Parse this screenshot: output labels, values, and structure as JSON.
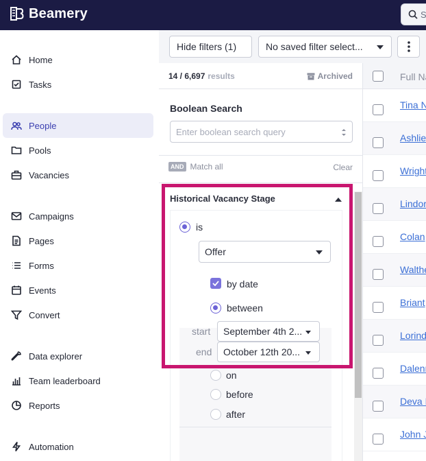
{
  "app": {
    "brand": "Beamery",
    "search_placeholder": "S"
  },
  "sidebar": {
    "items": [
      {
        "label": "Home",
        "icon": "home-icon"
      },
      {
        "label": "Tasks",
        "icon": "tasks-icon"
      },
      {
        "label": "People",
        "icon": "people-icon",
        "active": true
      },
      {
        "label": "Pools",
        "icon": "folder-icon"
      },
      {
        "label": "Vacancies",
        "icon": "briefcase-icon"
      },
      {
        "label": "Campaigns",
        "icon": "mail-icon"
      },
      {
        "label": "Pages",
        "icon": "page-icon"
      },
      {
        "label": "Forms",
        "icon": "list-icon"
      },
      {
        "label": "Events",
        "icon": "calendar-icon"
      },
      {
        "label": "Convert",
        "icon": "funnel-icon"
      },
      {
        "label": "Data explorer",
        "icon": "wrench-icon"
      },
      {
        "label": "Team leaderboard",
        "icon": "bar-chart-icon"
      },
      {
        "label": "Reports",
        "icon": "pie-chart-icon"
      },
      {
        "label": "Automation",
        "icon": "bolt-icon"
      }
    ]
  },
  "toolbar": {
    "hide_filters": "Hide filters (1)",
    "saved_filter": "No saved filter select..."
  },
  "results": {
    "count": "14 / 6,697",
    "label": "results",
    "archived": "Archived"
  },
  "boolean_search": {
    "title": "Boolean Search",
    "placeholder": "Enter boolean search query",
    "and_badge": "AND",
    "match_all": "Match all",
    "clear": "Clear"
  },
  "historical_vacancy_stage": {
    "title": "Historical Vacancy Stage",
    "is_label": "is",
    "stage_value": "Offer",
    "by_date_label": "by date",
    "between_label": "between",
    "start_label": "start",
    "start_value": "September 4th 2...",
    "end_label": "end",
    "end_value": "October 12th 20...",
    "on_label": "on",
    "before_label": "before",
    "after_label": "after"
  },
  "table": {
    "header": "Full Na",
    "rows": [
      "Tina N",
      "Ashlie",
      "Wright",
      "Lindor",
      "Colan",
      "Walthe",
      "Briant",
      "Lorind",
      "Dalenn",
      "Deva B",
      "John J"
    ]
  },
  "colors": {
    "topbar": "#1b1b44",
    "accent": "#6c63d6",
    "highlight": "#c8166f",
    "link": "#3b6fd6"
  }
}
